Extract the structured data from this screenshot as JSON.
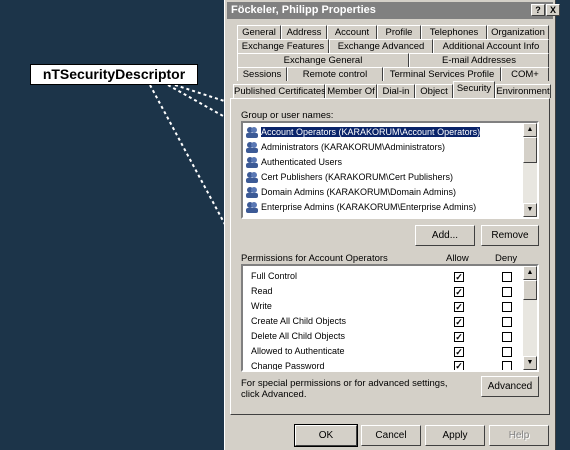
{
  "callout": {
    "text": "nTSecurityDescriptor"
  },
  "dialog": {
    "title": "Föckeler, Philipp Properties",
    "help_btn": "?",
    "close_btn": "X"
  },
  "tabs": {
    "row1": [
      "General",
      "Address",
      "Account",
      "Profile",
      "Telephones",
      "Organization"
    ],
    "row2": [
      "Exchange Features",
      "Exchange Advanced",
      "Additional Account Info"
    ],
    "row3": [
      "Exchange General",
      "E-mail Addresses"
    ],
    "row4": [
      "Sessions",
      "Remote control",
      "Terminal Services Profile",
      "COM+"
    ],
    "row5": [
      "Published Certificates",
      "Member Of",
      "Dial-in",
      "Object",
      "Security",
      "Environment"
    ],
    "active": "Security"
  },
  "groups": {
    "label": "Group or user names:",
    "items": [
      "Account Operators (KARAKORUM\\Account Operators)",
      "Administrators (KARAKORUM\\Administrators)",
      "Authenticated Users",
      "Cert Publishers (KARAKORUM\\Cert Publishers)",
      "Domain Admins (KARAKORUM\\Domain Admins)",
      "Enterprise Admins (KARAKORUM\\Enterprise Admins)"
    ],
    "selected_index": 0,
    "add_label": "Add...",
    "remove_label": "Remove"
  },
  "permissions": {
    "label": "Permissions for Account Operators",
    "allow_header": "Allow",
    "deny_header": "Deny",
    "rows": [
      {
        "name": "Full Control",
        "allow": true,
        "deny": false
      },
      {
        "name": "Read",
        "allow": true,
        "deny": false
      },
      {
        "name": "Write",
        "allow": true,
        "deny": false
      },
      {
        "name": "Create All Child Objects",
        "allow": true,
        "deny": false
      },
      {
        "name": "Delete All Child Objects",
        "allow": true,
        "deny": false
      },
      {
        "name": "Allowed to Authenticate",
        "allow": true,
        "deny": false
      },
      {
        "name": "Change Password",
        "allow": true,
        "deny": false
      }
    ]
  },
  "advanced": {
    "note_line1": "For special permissions or for advanced settings,",
    "note_line2": "click Advanced.",
    "button_label": "Advanced"
  },
  "footer": {
    "ok": "OK",
    "cancel": "Cancel",
    "apply": "Apply",
    "help": "Help"
  },
  "colors": {
    "background": "#1c3449",
    "dialog_face": "#d4d0c8",
    "selection": "#0a246a",
    "titlebar_inactive": "#808080"
  }
}
